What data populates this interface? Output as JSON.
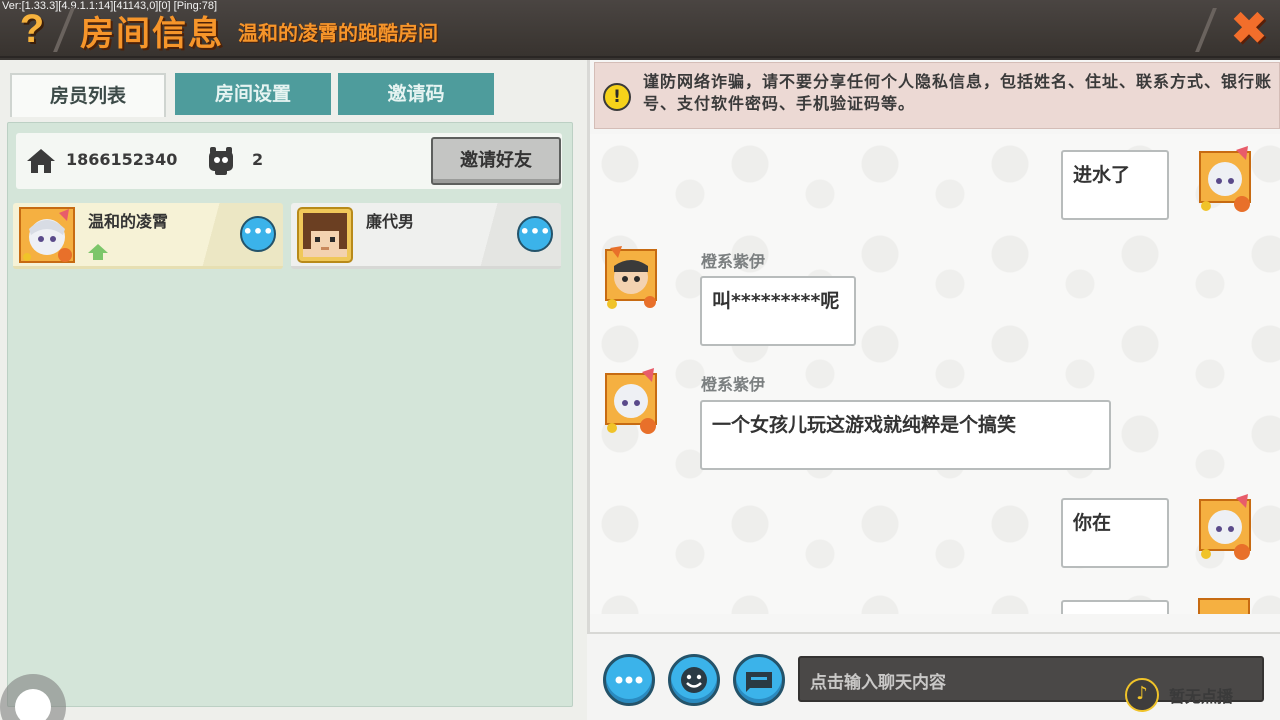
{
  "header": {
    "version": "Ver:[1.33.3][4.9.1.1:14][41143,0][0] [Ping:78]",
    "help_glyph": "?",
    "title": "房间信息",
    "room_name": "温和的凌霄的跑酷房间",
    "close_glyph": "✖"
  },
  "tabs": [
    {
      "label": "房员列表",
      "active": true
    },
    {
      "label": "房间设置",
      "active": false
    },
    {
      "label": "邀请码",
      "active": false
    }
  ],
  "room": {
    "room_id": "1866152340",
    "player_count": "2",
    "invite_friend_label": "邀请好友"
  },
  "members": [
    {
      "name": "温和的凌霄",
      "is_host": true,
      "more": "•••"
    },
    {
      "name": "廉代男",
      "is_host": false,
      "more": "•••"
    }
  ],
  "chat": {
    "warning": "谨防网络诈骗，请不要分享任何个人隐私信息，包括姓名、住址、联系方式、银行账号、支付软件密码、手机验证码等。",
    "messages": [
      {
        "side": "right",
        "sender": "",
        "text": "进水了"
      },
      {
        "side": "left",
        "sender": "橙系紫伊",
        "text": "叫*********呢"
      },
      {
        "side": "left",
        "sender": "橙系紫伊",
        "text": "一个女孩儿玩这游戏就纯粹是个搞笑"
      },
      {
        "side": "right",
        "sender": "",
        "text": "你在"
      }
    ],
    "input_placeholder": "点击输入聊天内容",
    "music_status": "暂无点播"
  },
  "colors": {
    "accent_orange": "#f6952a",
    "tab_teal": "#4e9c9c",
    "button_blue": "#3bb3ea",
    "panel_green": "#d4e5d9"
  }
}
